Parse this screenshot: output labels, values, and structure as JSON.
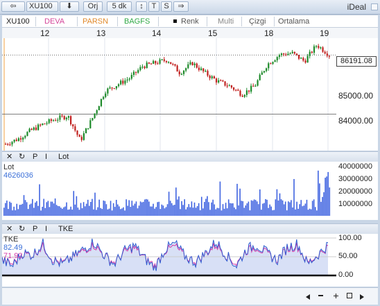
{
  "toolbar": {
    "back_icon": "⇦",
    "symbol": "XU100",
    "down_icon": "⬇",
    "orj": "Orj",
    "period": "5 dk",
    "tools": [
      "↕",
      "T",
      "S",
      "⇒"
    ],
    "brand": "iDeal"
  },
  "header": {
    "symbol": "XU100",
    "compare": [
      "DEVA",
      "PARSN",
      "BAGFS"
    ],
    "compare_colors": [
      "#d4469a",
      "#e0892a",
      "#2fa845"
    ],
    "renk": "Renk",
    "multi": "Multi",
    "cizgi": "Çizgi",
    "ortalama": "Ortalama"
  },
  "dates": [
    "12",
    "13",
    "14",
    "15",
    "18",
    "19"
  ],
  "price_axis": [
    "85000.00",
    "84000.00"
  ],
  "last_price": "86191.08",
  "lot_panel": {
    "title": "Lot",
    "name": "Lot",
    "value": "4626036",
    "axis": [
      "40000000",
      "30000000",
      "20000000",
      "10000000"
    ]
  },
  "tke_panel": {
    "title": "TKE",
    "name": "TKE",
    "value1": "82.49",
    "value2": "71.92",
    "axis": [
      "100.00",
      "50.00",
      "0.00"
    ]
  },
  "panel_buttons": [
    "✕",
    "↻",
    "P",
    "I"
  ],
  "chart_data": {
    "type": "candlestick",
    "categories": [
      "12",
      "13",
      "14",
      "15",
      "18",
      "19"
    ],
    "price_series": [
      83500,
      83650,
      83900,
      84100,
      84250,
      84350,
      83600,
      84300,
      85100,
      85300,
      85500,
      85850,
      85950,
      86050,
      85650,
      85950,
      85650,
      85400,
      85250,
      85000,
      85250,
      85900,
      86200,
      86250,
      86000,
      86500,
      86191
    ],
    "reference_lines": [
      86191.08,
      84400
    ],
    "ylim": [
      83300,
      86700
    ],
    "lot_ylim": [
      0,
      40000000
    ],
    "tke_ylim": [
      0,
      100
    ],
    "tke_values": [
      40,
      25,
      60,
      55,
      85,
      40,
      30,
      50,
      70,
      90,
      55,
      30,
      65,
      80,
      45,
      20,
      70,
      85,
      50,
      35,
      60,
      90,
      55,
      25,
      70,
      82,
      60,
      40,
      75,
      85,
      30,
      55,
      82
    ]
  }
}
